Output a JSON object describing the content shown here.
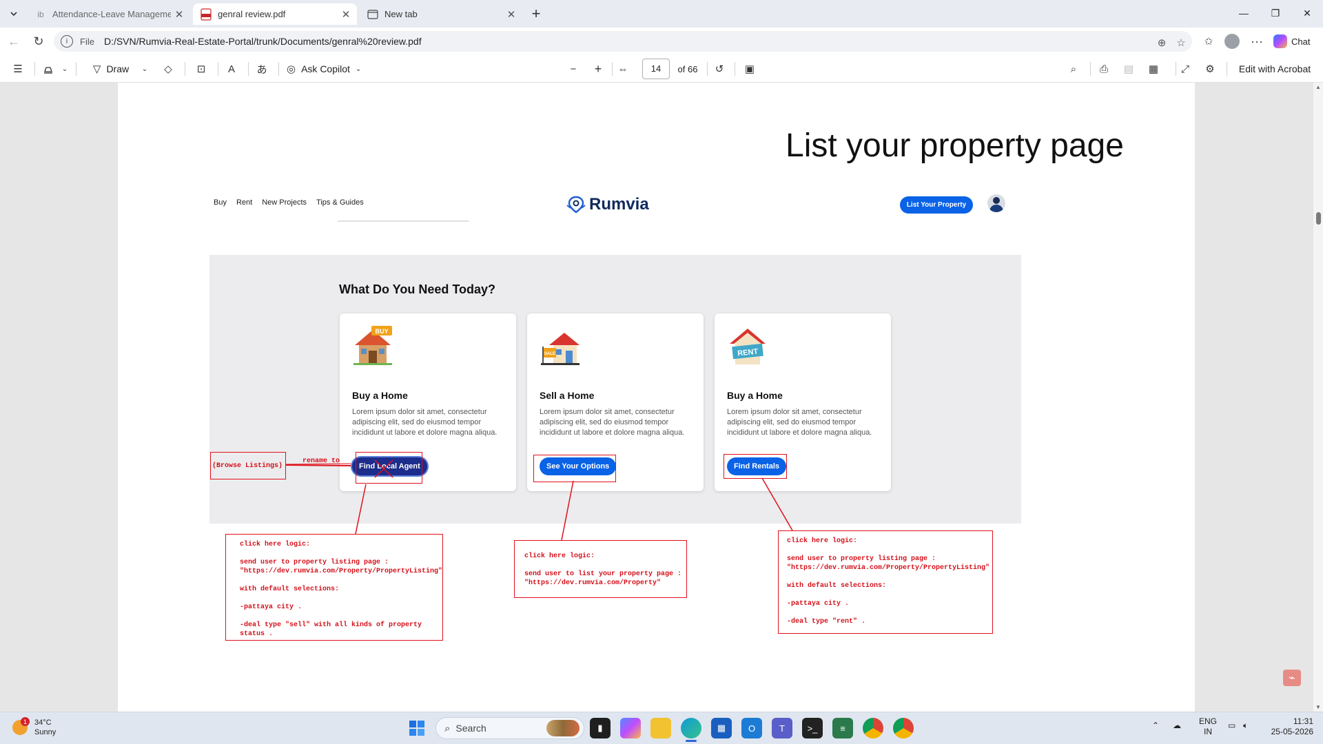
{
  "browser": {
    "tabs": [
      {
        "title": "Attendance-Leave Management S",
        "favicon": "ib"
      },
      {
        "title": "genral review.pdf",
        "favicon": "pdf"
      },
      {
        "title": "New tab",
        "favicon": "newtab-icon"
      }
    ],
    "address": {
      "scheme_label": "File",
      "url": "D:/SVN/Rumvia-Real-Estate-Portal/trunk/Documents/genral%20review.pdf"
    },
    "chat_label": "Chat"
  },
  "pdf_toolbar": {
    "draw_label": "Draw",
    "copilot_label": "Ask Copilot",
    "page_current": "14",
    "page_total": "of 66",
    "edit_label": "Edit with Acrobat"
  },
  "page": {
    "heading": "List your property page",
    "site": {
      "nav": [
        "Buy",
        "Rent",
        "New Projects",
        "Tips & Guides"
      ],
      "logo_text": "Rumvia",
      "list_property_button": "List Your Property"
    },
    "section_title": "What Do You Need Today?",
    "cards": [
      {
        "title": "Buy a Home",
        "icon_badge": "BUY",
        "description": "Lorem ipsum dolor sit amet, consectetur adipiscing elit, sed do eiusmod tempor incididunt ut labore et dolore magna aliqua.",
        "button": "Find Local Agent"
      },
      {
        "title": "Sell a Home",
        "icon_badge": "SALE",
        "description": "Lorem ipsum dolor sit amet, consectetur adipiscing elit, sed do eiusmod tempor incididunt ut labore et dolore magna aliqua.",
        "button": "See Your Options"
      },
      {
        "title": "Buy a Home",
        "icon_badge": "RENT",
        "description": "Lorem ipsum dolor sit amet, consectetur adipiscing elit, sed do eiusmod tempor incididunt ut labore et dolore magna aliqua.",
        "button": "Find Rentals"
      }
    ],
    "annotations": {
      "rename_label": "rename to",
      "rename_value": "(Browse Listings)",
      "note1": "click here logic:\n\nsend user to property listing page :\n\"https://dev.rumvia.com/Property/PropertyListing\"\n\nwith default selections:\n\n-pattaya city .\n\n-deal type \"sell\" with all kinds of property\nstatus .",
      "note2": "click here logic:\n\nsend user to list your property page :\n\"https://dev.rumvia.com/Property\"",
      "note3": "click here logic:\n\nsend user to property listing page :\n\"https://dev.rumvia.com/Property/PropertyListing\"\n\nwith default selections:\n\n-pattaya city .\n\n-deal type \"rent\" .",
      "color": "#e0101a"
    }
  },
  "taskbar": {
    "weather_temp": "34°C",
    "weather_desc": "Sunny",
    "weather_badge": "1",
    "search_label": "Search",
    "lang_top": "ENG",
    "lang_bottom": "IN",
    "time": "11:31",
    "date": "25-05-2026"
  }
}
